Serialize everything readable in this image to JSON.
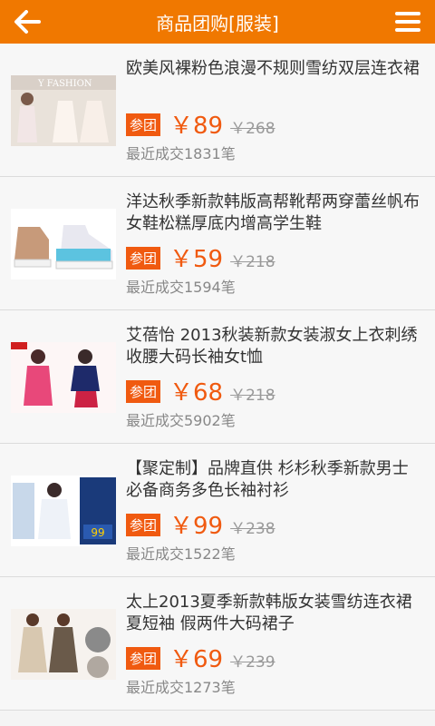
{
  "header": {
    "title": "商品团购[服装]",
    "back_icon": "back-arrow-icon",
    "menu_icon": "menu-icon",
    "color": "#f07800"
  },
  "items": [
    {
      "name": "欧美风裸粉色浪漫不规则雪纺双层连衣裙",
      "badge": "参团",
      "price": "￥89",
      "original_price": "￥268",
      "sold": "最近成交1831笔",
      "thumb_text": "Y FASHION"
    },
    {
      "name": "洋达秋季新款韩版高帮靴帮两穿蕾丝帆布女鞋松糕厚底内增高学生鞋",
      "badge": "参团",
      "price": "￥59",
      "original_price": "￥218",
      "sold": "最近成交1594笔",
      "thumb_text": ""
    },
    {
      "name": "艾蓓怡 2013秋装新款女装淑女上衣刺绣收腰大码长袖女t恤",
      "badge": "参团",
      "price": "￥68",
      "original_price": "￥218",
      "sold": "最近成交5902笔",
      "thumb_text": ""
    },
    {
      "name": "【聚定制】品牌直供 杉杉秋季新款男士必备商务多色长袖衬衫",
      "badge": "参团",
      "price": "￥99",
      "original_price": "￥238",
      "sold": "最近成交1522笔",
      "thumb_text": "99"
    },
    {
      "name": "太上2013夏季新款韩版女装雪纺连衣裙夏短袖 假两件大码裙子",
      "badge": "参团",
      "price": "￥69",
      "original_price": "￥239",
      "sold": "最近成交1273笔",
      "thumb_text": ""
    }
  ]
}
